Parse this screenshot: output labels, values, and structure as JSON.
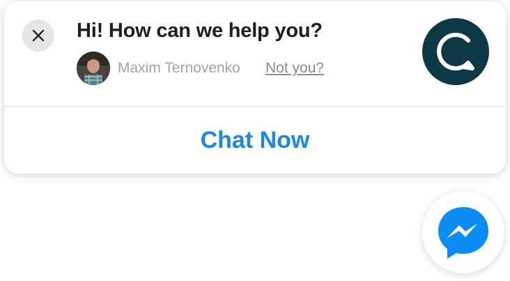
{
  "popup": {
    "title": "Hi! How can we help you?",
    "agent": {
      "name": "Maxim Ternovenko",
      "not_you_label": "Not you?"
    },
    "cta_label": "Chat Now",
    "icons": {
      "close": "close-icon",
      "brand": "chat-bubble-logo-icon",
      "fab": "messenger-icon"
    }
  },
  "colors": {
    "accent": "#1a86e8",
    "brand_dark": "#0e3a47",
    "messenger_blue": "#0a8cf4",
    "close_bg": "#e6e6e6"
  }
}
